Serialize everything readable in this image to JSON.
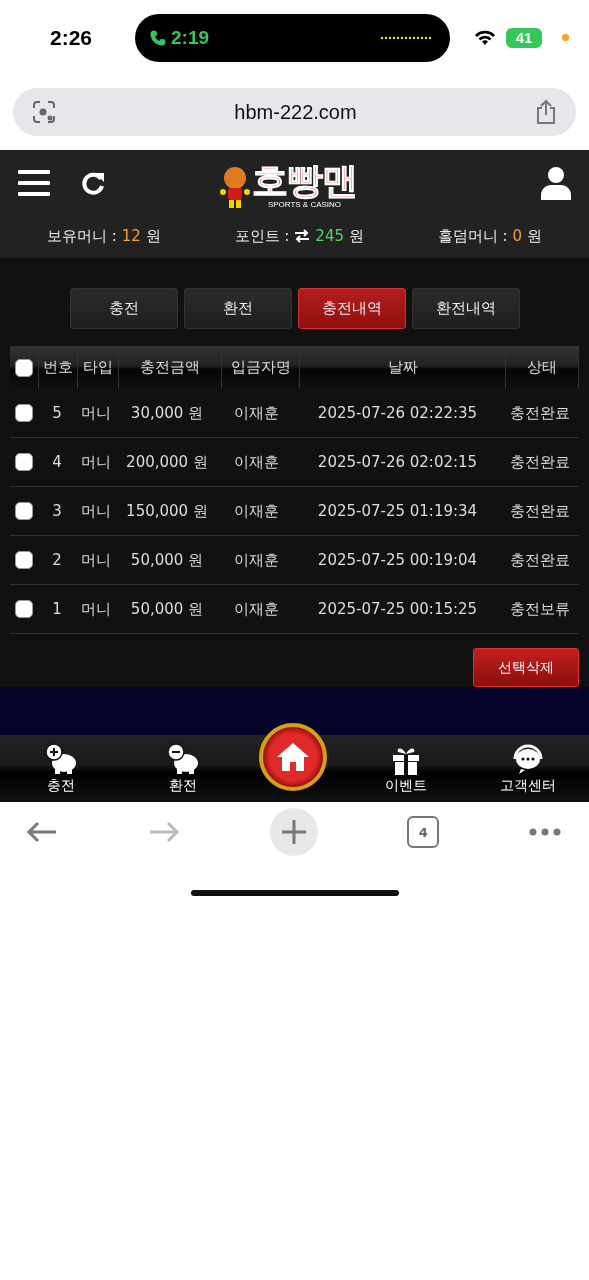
{
  "status_bar": {
    "time": "2:26",
    "call_time": "2:19",
    "battery": "41"
  },
  "browser": {
    "url": "hbm-222.com",
    "tab_count": "4"
  },
  "header": {
    "logo_text": "호빵맨",
    "logo_subtitle": "SPORTS & CASINO"
  },
  "balances": [
    {
      "label": "보유머니 :",
      "value": "12",
      "unit": "원",
      "color": "#f0a030",
      "kind": "plain"
    },
    {
      "label": "포인트 :",
      "value": "245",
      "unit": "원",
      "color": "#4cd964",
      "kind": "exchange"
    },
    {
      "label": "홀덤머니 :",
      "value": "0",
      "unit": "원",
      "color": "#f0a030",
      "kind": "plain"
    }
  ],
  "tabs": [
    {
      "label": "충전",
      "selected": false
    },
    {
      "label": "환전",
      "selected": false
    },
    {
      "label": "충전내역",
      "selected": true
    },
    {
      "label": "환전내역",
      "selected": false
    }
  ],
  "table": {
    "all_checked": false,
    "columns": [
      "번호",
      "타입",
      "충전금액",
      "입금자명",
      "날짜",
      "상태"
    ],
    "rows": [
      {
        "checked": false,
        "cells": [
          "5",
          "머니",
          "30,000 원",
          "이재훈",
          "2025-07-26 02:22:35",
          "충전완료"
        ]
      },
      {
        "checked": false,
        "cells": [
          "4",
          "머니",
          "200,000 원",
          "이재훈",
          "2025-07-26 02:02:15",
          "충전완료"
        ]
      },
      {
        "checked": false,
        "cells": [
          "3",
          "머니",
          "150,000 원",
          "이재훈",
          "2025-07-25 01:19:34",
          "충전완료"
        ]
      },
      {
        "checked": false,
        "cells": [
          "2",
          "머니",
          "50,000 원",
          "이재훈",
          "2025-07-25 00:19:04",
          "충전완료"
        ]
      },
      {
        "checked": false,
        "cells": [
          "1",
          "머니",
          "50,000 원",
          "이재훈",
          "2025-07-25 00:15:25",
          "충전보류"
        ]
      }
    ]
  },
  "delete_button": "선택삭제",
  "bottom_nav": [
    {
      "kind": "charge",
      "label": "충전"
    },
    {
      "kind": "withdraw",
      "label": "환전"
    },
    {
      "kind": "home"
    },
    {
      "kind": "event",
      "label": "이벤트"
    },
    {
      "kind": "support",
      "label": "고객센터"
    }
  ]
}
